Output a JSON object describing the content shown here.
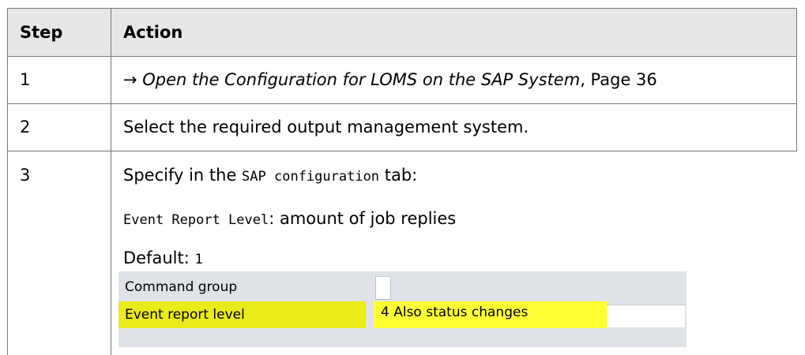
{
  "table": {
    "headers": {
      "step": "Step",
      "action": "Action"
    },
    "row1": {
      "step": "1",
      "arrow": "→ ",
      "link": "Open the Configuration for LOMS on the SAP System",
      "suffix": ", Page 36"
    },
    "row2": {
      "step": "2",
      "action": "Select the required output management system."
    },
    "row3": {
      "step": "3",
      "line1_pre": "Specify in the ",
      "line1_code": "SAP configuration",
      "line1_post": " tab:",
      "line2_code": "Event Report Level",
      "line2_post": ": amount of job replies",
      "line3_pre": "Default: ",
      "line3_code": "1"
    }
  },
  "sap_screenshot": {
    "command_group_label": "Command group",
    "event_report_level_label": "Event report level",
    "event_report_level_value": "4 Also status changes",
    "highlight_color": "#ffff33"
  }
}
